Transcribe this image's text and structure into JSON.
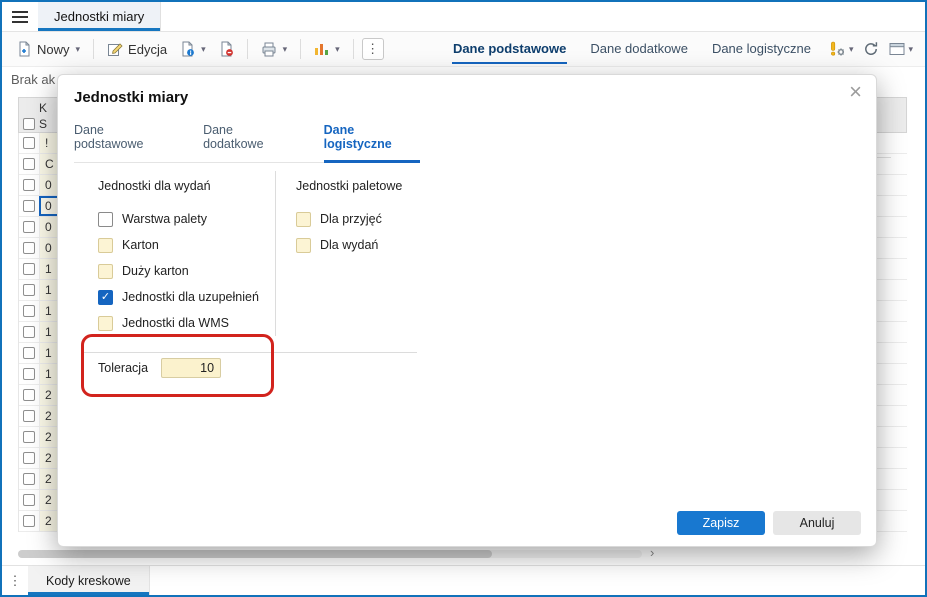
{
  "icons": {
    "chevron_down": "▾",
    "kebab": "⋮",
    "close": "×",
    "check": "✓",
    "scroll_right": "›"
  },
  "colors": {
    "window_border": "#1172ba",
    "accent_blue": "#1565c0",
    "save_button": "#1878d0",
    "annotation_red": "#d2231d",
    "soft_checkbox_bg": "#fcf4d4"
  },
  "top_bar": {
    "document_tab": "Jednostki miary"
  },
  "toolbar": {
    "new_label": "Nowy",
    "edit_label": "Edycja",
    "view_tabs": [
      {
        "label": "Dane podstawowe",
        "active": true
      },
      {
        "label": "Dane dodatkowe",
        "active": false
      },
      {
        "label": "Dane logistyczne",
        "active": false
      }
    ]
  },
  "status": {
    "filter_text": "Brak ak"
  },
  "grid": {
    "header": {
      "line1": "K",
      "line2": "S"
    },
    "selected_index": 3,
    "rows": [
      "!",
      "C",
      "0",
      "0",
      "0",
      "0",
      "1",
      "1",
      "1",
      "1",
      "1",
      "1",
      "2",
      "2",
      "2",
      "2",
      "2",
      "2",
      "2"
    ]
  },
  "dialog": {
    "title": "Jednostki miary",
    "tabs": [
      {
        "label": "Dane podstawowe",
        "active": false
      },
      {
        "label": "Dane dodatkowe",
        "active": false
      },
      {
        "label": "Dane logistyczne",
        "active": true
      }
    ],
    "groups": [
      {
        "title": "Jednostki dla wydań",
        "checkboxes": [
          {
            "label": "Warstwa palety",
            "state": "unchecked"
          },
          {
            "label": "Karton",
            "state": "soft"
          },
          {
            "label": "Duży karton",
            "state": "soft"
          },
          {
            "label": "Jednostki dla uzupełnień",
            "state": "checked"
          },
          {
            "label": "Jednostki dla WMS",
            "state": "soft"
          }
        ]
      },
      {
        "title": "Jednostki paletowe",
        "checkboxes": [
          {
            "label": "Dla przyjęć",
            "state": "soft"
          },
          {
            "label": "Dla wydań",
            "state": "soft"
          }
        ]
      }
    ],
    "tolerance": {
      "label": "Toleracja",
      "value": "10"
    },
    "buttons": {
      "save": "Zapisz",
      "cancel": "Anuluj"
    }
  },
  "bottom_bar": {
    "tab": "Kody kreskowe"
  }
}
